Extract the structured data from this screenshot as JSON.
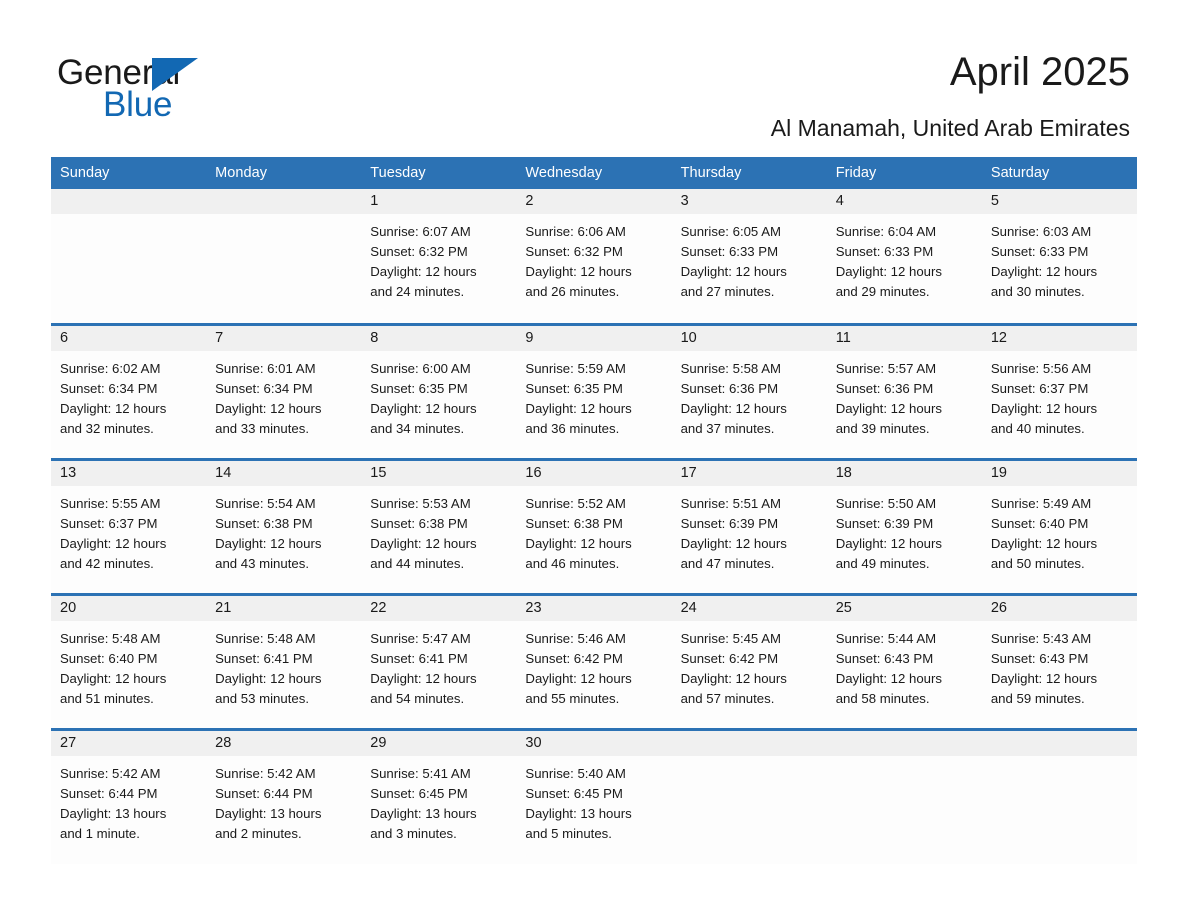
{
  "brand": {
    "name_part1": "General",
    "name_part2": "Blue",
    "triangle_icon": "triangle-icon",
    "colors": {
      "blue": "#1268b3",
      "black": "#1a1a1a"
    }
  },
  "header": {
    "title": "April 2025",
    "subtitle": "Al Manamah, United Arab Emirates"
  },
  "calendar": {
    "colors": {
      "header_bg": "#2c72b4",
      "header_text": "#ffffff",
      "daynum_band": "#f0f0f0",
      "cell_bg": "#fdfdfd",
      "divider": "#2c72b4"
    },
    "weekday_headers": [
      "Sunday",
      "Monday",
      "Tuesday",
      "Wednesday",
      "Thursday",
      "Friday",
      "Saturday"
    ],
    "weeks": [
      [
        {
          "day": "",
          "lines": []
        },
        {
          "day": "",
          "lines": []
        },
        {
          "day": "1",
          "lines": [
            "Sunrise: 6:07 AM",
            "Sunset: 6:32 PM",
            "Daylight: 12 hours",
            "and 24 minutes."
          ]
        },
        {
          "day": "2",
          "lines": [
            "Sunrise: 6:06 AM",
            "Sunset: 6:32 PM",
            "Daylight: 12 hours",
            "and 26 minutes."
          ]
        },
        {
          "day": "3",
          "lines": [
            "Sunrise: 6:05 AM",
            "Sunset: 6:33 PM",
            "Daylight: 12 hours",
            "and 27 minutes."
          ]
        },
        {
          "day": "4",
          "lines": [
            "Sunrise: 6:04 AM",
            "Sunset: 6:33 PM",
            "Daylight: 12 hours",
            "and 29 minutes."
          ]
        },
        {
          "day": "5",
          "lines": [
            "Sunrise: 6:03 AM",
            "Sunset: 6:33 PM",
            "Daylight: 12 hours",
            "and 30 minutes."
          ]
        }
      ],
      [
        {
          "day": "6",
          "lines": [
            "Sunrise: 6:02 AM",
            "Sunset: 6:34 PM",
            "Daylight: 12 hours",
            "and 32 minutes."
          ]
        },
        {
          "day": "7",
          "lines": [
            "Sunrise: 6:01 AM",
            "Sunset: 6:34 PM",
            "Daylight: 12 hours",
            "and 33 minutes."
          ]
        },
        {
          "day": "8",
          "lines": [
            "Sunrise: 6:00 AM",
            "Sunset: 6:35 PM",
            "Daylight: 12 hours",
            "and 34 minutes."
          ]
        },
        {
          "day": "9",
          "lines": [
            "Sunrise: 5:59 AM",
            "Sunset: 6:35 PM",
            "Daylight: 12 hours",
            "and 36 minutes."
          ]
        },
        {
          "day": "10",
          "lines": [
            "Sunrise: 5:58 AM",
            "Sunset: 6:36 PM",
            "Daylight: 12 hours",
            "and 37 minutes."
          ]
        },
        {
          "day": "11",
          "lines": [
            "Sunrise: 5:57 AM",
            "Sunset: 6:36 PM",
            "Daylight: 12 hours",
            "and 39 minutes."
          ]
        },
        {
          "day": "12",
          "lines": [
            "Sunrise: 5:56 AM",
            "Sunset: 6:37 PM",
            "Daylight: 12 hours",
            "and 40 minutes."
          ]
        }
      ],
      [
        {
          "day": "13",
          "lines": [
            "Sunrise: 5:55 AM",
            "Sunset: 6:37 PM",
            "Daylight: 12 hours",
            "and 42 minutes."
          ]
        },
        {
          "day": "14",
          "lines": [
            "Sunrise: 5:54 AM",
            "Sunset: 6:38 PM",
            "Daylight: 12 hours",
            "and 43 minutes."
          ]
        },
        {
          "day": "15",
          "lines": [
            "Sunrise: 5:53 AM",
            "Sunset: 6:38 PM",
            "Daylight: 12 hours",
            "and 44 minutes."
          ]
        },
        {
          "day": "16",
          "lines": [
            "Sunrise: 5:52 AM",
            "Sunset: 6:38 PM",
            "Daylight: 12 hours",
            "and 46 minutes."
          ]
        },
        {
          "day": "17",
          "lines": [
            "Sunrise: 5:51 AM",
            "Sunset: 6:39 PM",
            "Daylight: 12 hours",
            "and 47 minutes."
          ]
        },
        {
          "day": "18",
          "lines": [
            "Sunrise: 5:50 AM",
            "Sunset: 6:39 PM",
            "Daylight: 12 hours",
            "and 49 minutes."
          ]
        },
        {
          "day": "19",
          "lines": [
            "Sunrise: 5:49 AM",
            "Sunset: 6:40 PM",
            "Daylight: 12 hours",
            "and 50 minutes."
          ]
        }
      ],
      [
        {
          "day": "20",
          "lines": [
            "Sunrise: 5:48 AM",
            "Sunset: 6:40 PM",
            "Daylight: 12 hours",
            "and 51 minutes."
          ]
        },
        {
          "day": "21",
          "lines": [
            "Sunrise: 5:48 AM",
            "Sunset: 6:41 PM",
            "Daylight: 12 hours",
            "and 53 minutes."
          ]
        },
        {
          "day": "22",
          "lines": [
            "Sunrise: 5:47 AM",
            "Sunset: 6:41 PM",
            "Daylight: 12 hours",
            "and 54 minutes."
          ]
        },
        {
          "day": "23",
          "lines": [
            "Sunrise: 5:46 AM",
            "Sunset: 6:42 PM",
            "Daylight: 12 hours",
            "and 55 minutes."
          ]
        },
        {
          "day": "24",
          "lines": [
            "Sunrise: 5:45 AM",
            "Sunset: 6:42 PM",
            "Daylight: 12 hours",
            "and 57 minutes."
          ]
        },
        {
          "day": "25",
          "lines": [
            "Sunrise: 5:44 AM",
            "Sunset: 6:43 PM",
            "Daylight: 12 hours",
            "and 58 minutes."
          ]
        },
        {
          "day": "26",
          "lines": [
            "Sunrise: 5:43 AM",
            "Sunset: 6:43 PM",
            "Daylight: 12 hours",
            "and 59 minutes."
          ]
        }
      ],
      [
        {
          "day": "27",
          "lines": [
            "Sunrise: 5:42 AM",
            "Sunset: 6:44 PM",
            "Daylight: 13 hours",
            "and 1 minute."
          ]
        },
        {
          "day": "28",
          "lines": [
            "Sunrise: 5:42 AM",
            "Sunset: 6:44 PM",
            "Daylight: 13 hours",
            "and 2 minutes."
          ]
        },
        {
          "day": "29",
          "lines": [
            "Sunrise: 5:41 AM",
            "Sunset: 6:45 PM",
            "Daylight: 13 hours",
            "and 3 minutes."
          ]
        },
        {
          "day": "30",
          "lines": [
            "Sunrise: 5:40 AM",
            "Sunset: 6:45 PM",
            "Daylight: 13 hours",
            "and 5 minutes."
          ]
        },
        {
          "day": "",
          "lines": []
        },
        {
          "day": "",
          "lines": []
        },
        {
          "day": "",
          "lines": []
        }
      ]
    ]
  }
}
